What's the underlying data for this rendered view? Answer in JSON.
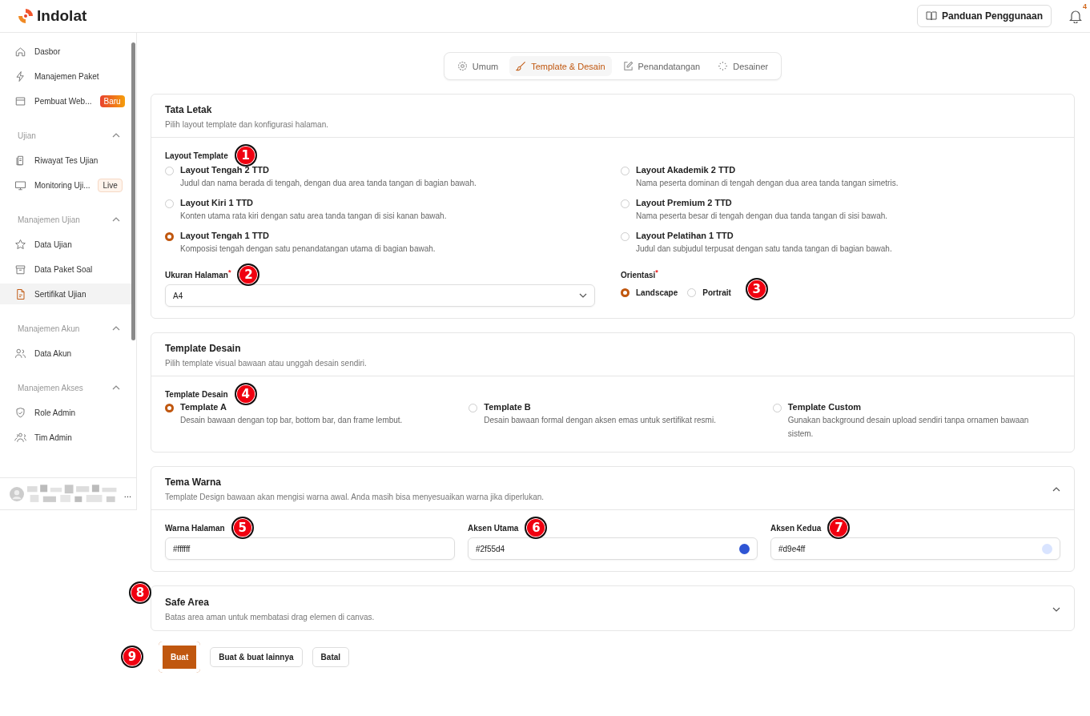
{
  "header": {
    "logo": "Indolat",
    "guide_button": "Panduan Penggunaan",
    "notification_count": "4"
  },
  "sidebar": {
    "groups": [
      {
        "items": [
          {
            "label": "Dasbor",
            "selected": false
          },
          {
            "label": "Manajemen Paket",
            "selected": false
          },
          {
            "label": "Pembuat Web...",
            "selected": false,
            "badge": "Baru",
            "kind": "new"
          }
        ]
      },
      {
        "title": "Ujian",
        "expanded": true,
        "items": [
          {
            "label": "Riwayat Tes Ujian",
            "selected": false
          },
          {
            "label": "Monitoring Uji...",
            "selected": false,
            "badge": "Live",
            "kind": "live"
          }
        ]
      },
      {
        "title": "Manajemen Ujian",
        "expanded": true,
        "items": [
          {
            "label": "Data Ujian",
            "selected": false
          },
          {
            "label": "Data Paket Soal",
            "selected": false
          },
          {
            "label": "Sertifikat Ujian",
            "selected": true
          }
        ]
      },
      {
        "title": "Manajemen Akun",
        "expanded": true,
        "items": [
          {
            "label": "Data Akun",
            "selected": false
          }
        ]
      },
      {
        "title": "Manajemen Akses",
        "expanded": true,
        "items": [
          {
            "label": "Role Admin",
            "selected": false
          },
          {
            "label": "Tim Admin",
            "selected": false
          }
        ]
      }
    ],
    "user": {
      "more": "..."
    }
  },
  "tabs": [
    {
      "label": "Umum",
      "selected": false
    },
    {
      "label": "Template & Desain",
      "selected": true
    },
    {
      "label": "Penandatangan",
      "selected": false
    },
    {
      "label": "Desainer",
      "selected": false
    }
  ],
  "layout_section": {
    "title": "Tata Letak",
    "subtitle": "Pilih layout template dan konfigurasi halaman.",
    "group_label": "Layout Template",
    "marker": "1",
    "options": [
      {
        "label": "Layout Tengah 2 TTD",
        "description": "Judul dan nama berada di tengah, dengan dua area tanda tangan di bagian bawah.",
        "selected": false
      },
      {
        "label": "Layout Akademik 2 TTD",
        "description": "Nama peserta dominan di tengah dengan dua area tanda tangan simetris.",
        "selected": false
      },
      {
        "label": "Layout Kiri 1 TTD",
        "description": "Konten utama rata kiri dengan satu area tanda tangan di sisi kanan bawah.",
        "selected": false
      },
      {
        "label": "Layout Premium 2 TTD",
        "description": "Nama peserta besar di tengah dengan dua tanda tangan di sisi bawah.",
        "selected": false
      },
      {
        "label": "Layout Tengah 1 TTD",
        "description": "Komposisi tengah dengan satu penandatangan utama di bagian bawah.",
        "selected": true
      },
      {
        "label": "Layout Pelatihan 1 TTD",
        "description": "Judul dan subjudul terpusat dengan satu tanda tangan di bagian bawah.",
        "selected": false
      }
    ],
    "page_size": {
      "label": "Ukuran Halaman",
      "required_mark": "*",
      "value": "A4",
      "marker": "2"
    },
    "orientation": {
      "label": "Orientasi",
      "required_mark": "*",
      "marker": "3",
      "options": [
        {
          "label": "Landscape",
          "selected": true
        },
        {
          "label": "Portrait",
          "selected": false
        }
      ]
    }
  },
  "design_section": {
    "title": "Template Desain",
    "subtitle": "Pilih template visual bawaan atau unggah desain sendiri.",
    "group_label": "Template Desain",
    "marker": "4",
    "options": [
      {
        "label": "Template A",
        "description": "Desain bawaan dengan top bar, bottom bar, dan frame lembut.",
        "selected": true
      },
      {
        "label": "Template B",
        "description": "Desain bawaan formal dengan aksen emas untuk sertifikat resmi.",
        "selected": false
      },
      {
        "label": "Template Custom",
        "description": "Gunakan background desain upload sendiri tanpa ornamen bawaan sistem.",
        "selected": false
      }
    ]
  },
  "color_section": {
    "title": "Tema Warna",
    "subtitle": "Template Design bawaan akan mengisi warna awal. Anda masih bisa menyesuaikan warna jika diperlukan.",
    "expanded": true,
    "fields": [
      {
        "label": "Warna Halaman",
        "value": "#ffffff",
        "marker": "5"
      },
      {
        "label": "Aksen Utama",
        "value": "#2f55d4",
        "color": "#2f55d4",
        "marker": "6"
      },
      {
        "label": "Aksen Kedua",
        "value": "#d9e4ff",
        "color": "#d9e4ff",
        "marker": "7"
      }
    ]
  },
  "safe_area_section": {
    "title": "Safe Area",
    "subtitle": "Batas area aman untuk membatasi drag elemen di canvas.",
    "expanded": false,
    "marker": "8"
  },
  "actions": [
    {
      "label": "Buat",
      "kind": "primary",
      "highlighted": true,
      "marker": "9"
    },
    {
      "label": "Buat & buat lainnya",
      "kind": "secondary",
      "highlighted": false
    },
    {
      "label": "Batal",
      "kind": "secondary",
      "highlighted": false
    }
  ]
}
